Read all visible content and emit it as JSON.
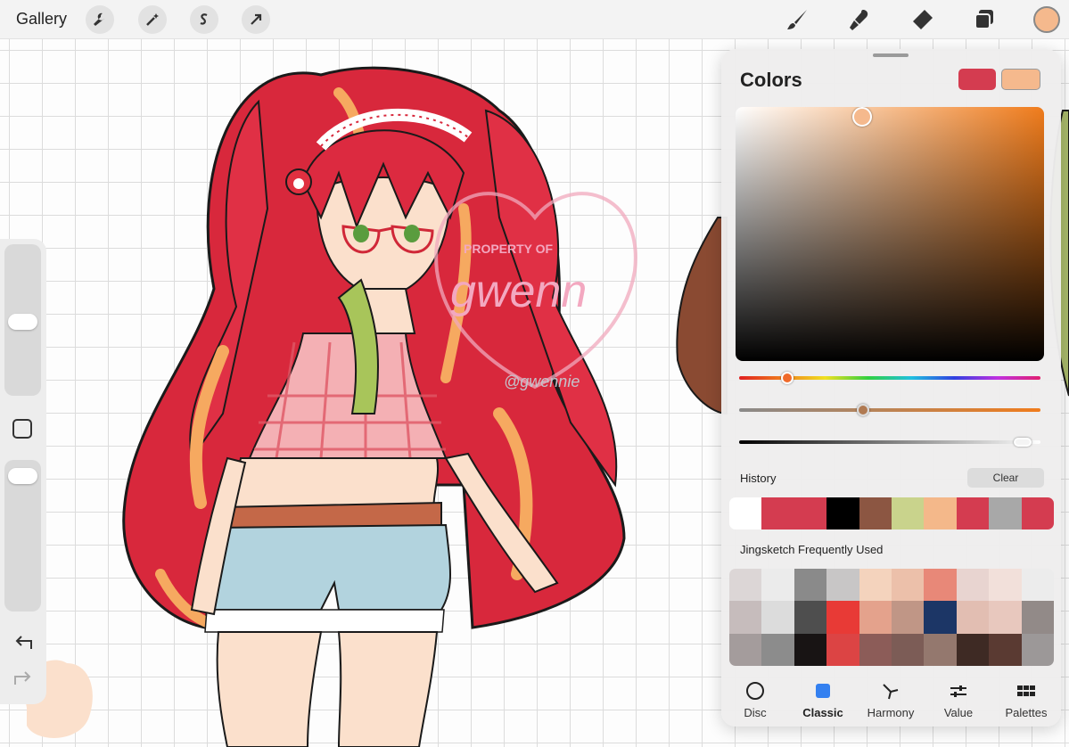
{
  "app": {
    "gallery_label": "Gallery"
  },
  "toolbar": {
    "left_icons": [
      "wrench-icon",
      "magic-wand-icon",
      "selection-icon",
      "transform-arrow-icon"
    ],
    "right_icons": [
      "brush-icon",
      "smudge-icon",
      "eraser-icon",
      "layers-icon"
    ],
    "current_color": "#f5b98d"
  },
  "colors_panel": {
    "title": "Colors",
    "primary_color": "#d43c50",
    "secondary_color": "#f5b98d",
    "picker": {
      "hue_color": "#f07c1c",
      "saturation": 0.41,
      "brightness": 0.96,
      "hue_slider": 0.16,
      "saturation_slider": 0.41,
      "brightness_slider": 0.94
    },
    "history_label": "History",
    "clear_label": "Clear",
    "history_colors": [
      "#ffffff",
      "#d43c50",
      "#d43c50",
      "#000000",
      "#8c5642",
      "#c9d38c",
      "#f4b88a",
      "#d43c50",
      "#a8a8a8",
      "#d43c50"
    ],
    "palette_label": "Jingsketch Frequently Used",
    "palette_colors": [
      "#dcd6d6",
      "#ebebeb",
      "#8a8a8a",
      "#c8c6c6",
      "#f4d3bd",
      "#ecc0aa",
      "#e88878",
      "#e8d4d0",
      "#f2e0da",
      "#ececec",
      "#c6bcbc",
      "#dcdcdc",
      "#4e4e4e",
      "#e83a36",
      "#e4a28c",
      "#c09686",
      "#1c3666",
      "#e2beb2",
      "#e8c8be",
      "#928a88",
      "#a49c9c",
      "#8c8c8c",
      "#181414",
      "#dc4444",
      "#8c5c58",
      "#7c5c56",
      "#94786e",
      "#3e2a24",
      "#5a3a32",
      "#9c9898"
    ],
    "tabs": [
      {
        "label": "Disc",
        "icon": "disc-icon"
      },
      {
        "label": "Classic",
        "icon": "classic-square-icon"
      },
      {
        "label": "Harmony",
        "icon": "harmony-icon"
      },
      {
        "label": "Value",
        "icon": "value-sliders-icon"
      },
      {
        "label": "Palettes",
        "icon": "palettes-grid-icon"
      }
    ],
    "active_tab": "Classic"
  },
  "sidebar": {
    "brush_size": 0.12,
    "opacity": 0.06,
    "icons": [
      "modifier-square-icon",
      "undo-icon",
      "redo-icon"
    ]
  },
  "canvas": {
    "watermark_lines": [
      "PROPERTY OF",
      "gwenn",
      "@gwennie"
    ]
  }
}
